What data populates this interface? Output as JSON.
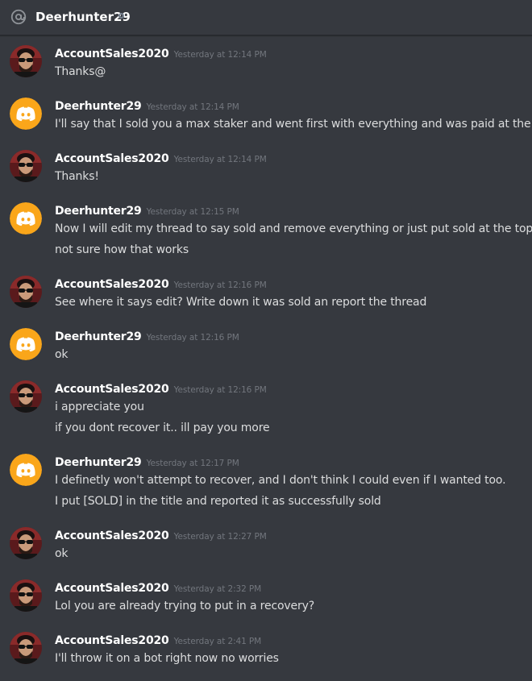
{
  "header": {
    "title": "Deerhunter29",
    "icon": "at-icon"
  },
  "colors": {
    "background": "#36393f",
    "discord_avatar": "#faa61a",
    "username": "#ffffff",
    "text": "#dcddde",
    "timestamp": "#72767d"
  },
  "messages": [
    {
      "author": "AccountSales2020",
      "avatar": "photo",
      "timestamp": "Yesterday at 12:14 PM",
      "lines": [
        "Thanks@"
      ]
    },
    {
      "author": "Deerhunter29",
      "avatar": "discord",
      "timestamp": "Yesterday at 12:14 PM",
      "lines": [
        "I'll say that I sold you a max staker and went first with everything and was paid at the end"
      ]
    },
    {
      "author": "AccountSales2020",
      "avatar": "photo",
      "timestamp": "Yesterday at 12:14 PM",
      "lines": [
        "Thanks!"
      ]
    },
    {
      "author": "Deerhunter29",
      "avatar": "discord",
      "timestamp": "Yesterday at 12:15 PM",
      "lines": [
        "Now I will edit my thread to say sold and remove everything or just put sold at the top?",
        "not sure how that works"
      ]
    },
    {
      "author": "AccountSales2020",
      "avatar": "photo",
      "timestamp": "Yesterday at 12:16 PM",
      "lines": [
        "See where it says edit? Write down it was sold an report the thread"
      ]
    },
    {
      "author": "Deerhunter29",
      "avatar": "discord",
      "timestamp": "Yesterday at 12:16 PM",
      "lines": [
        "ok"
      ]
    },
    {
      "author": "AccountSales2020",
      "avatar": "photo",
      "timestamp": "Yesterday at 12:16 PM",
      "lines": [
        "i appreciate you",
        "if you dont recover it.. ill pay you more"
      ]
    },
    {
      "author": "Deerhunter29",
      "avatar": "discord",
      "timestamp": "Yesterday at 12:17 PM",
      "lines": [
        "I definetly won't attempt to recover, and I don't think I could even if I wanted too.",
        "I put [SOLD] in the title and reported it as successfully sold"
      ]
    },
    {
      "author": "AccountSales2020",
      "avatar": "photo",
      "timestamp": "Yesterday at 12:27 PM",
      "lines": [
        "ok"
      ]
    },
    {
      "author": "AccountSales2020",
      "avatar": "photo",
      "timestamp": "Yesterday at 2:32 PM",
      "lines": [
        "Lol you are already trying to put in a recovery?"
      ]
    },
    {
      "author": "AccountSales2020",
      "avatar": "photo",
      "timestamp": "Yesterday at 2:41 PM",
      "lines": [
        "I'll throw it on a bot right now no worries"
      ]
    }
  ]
}
